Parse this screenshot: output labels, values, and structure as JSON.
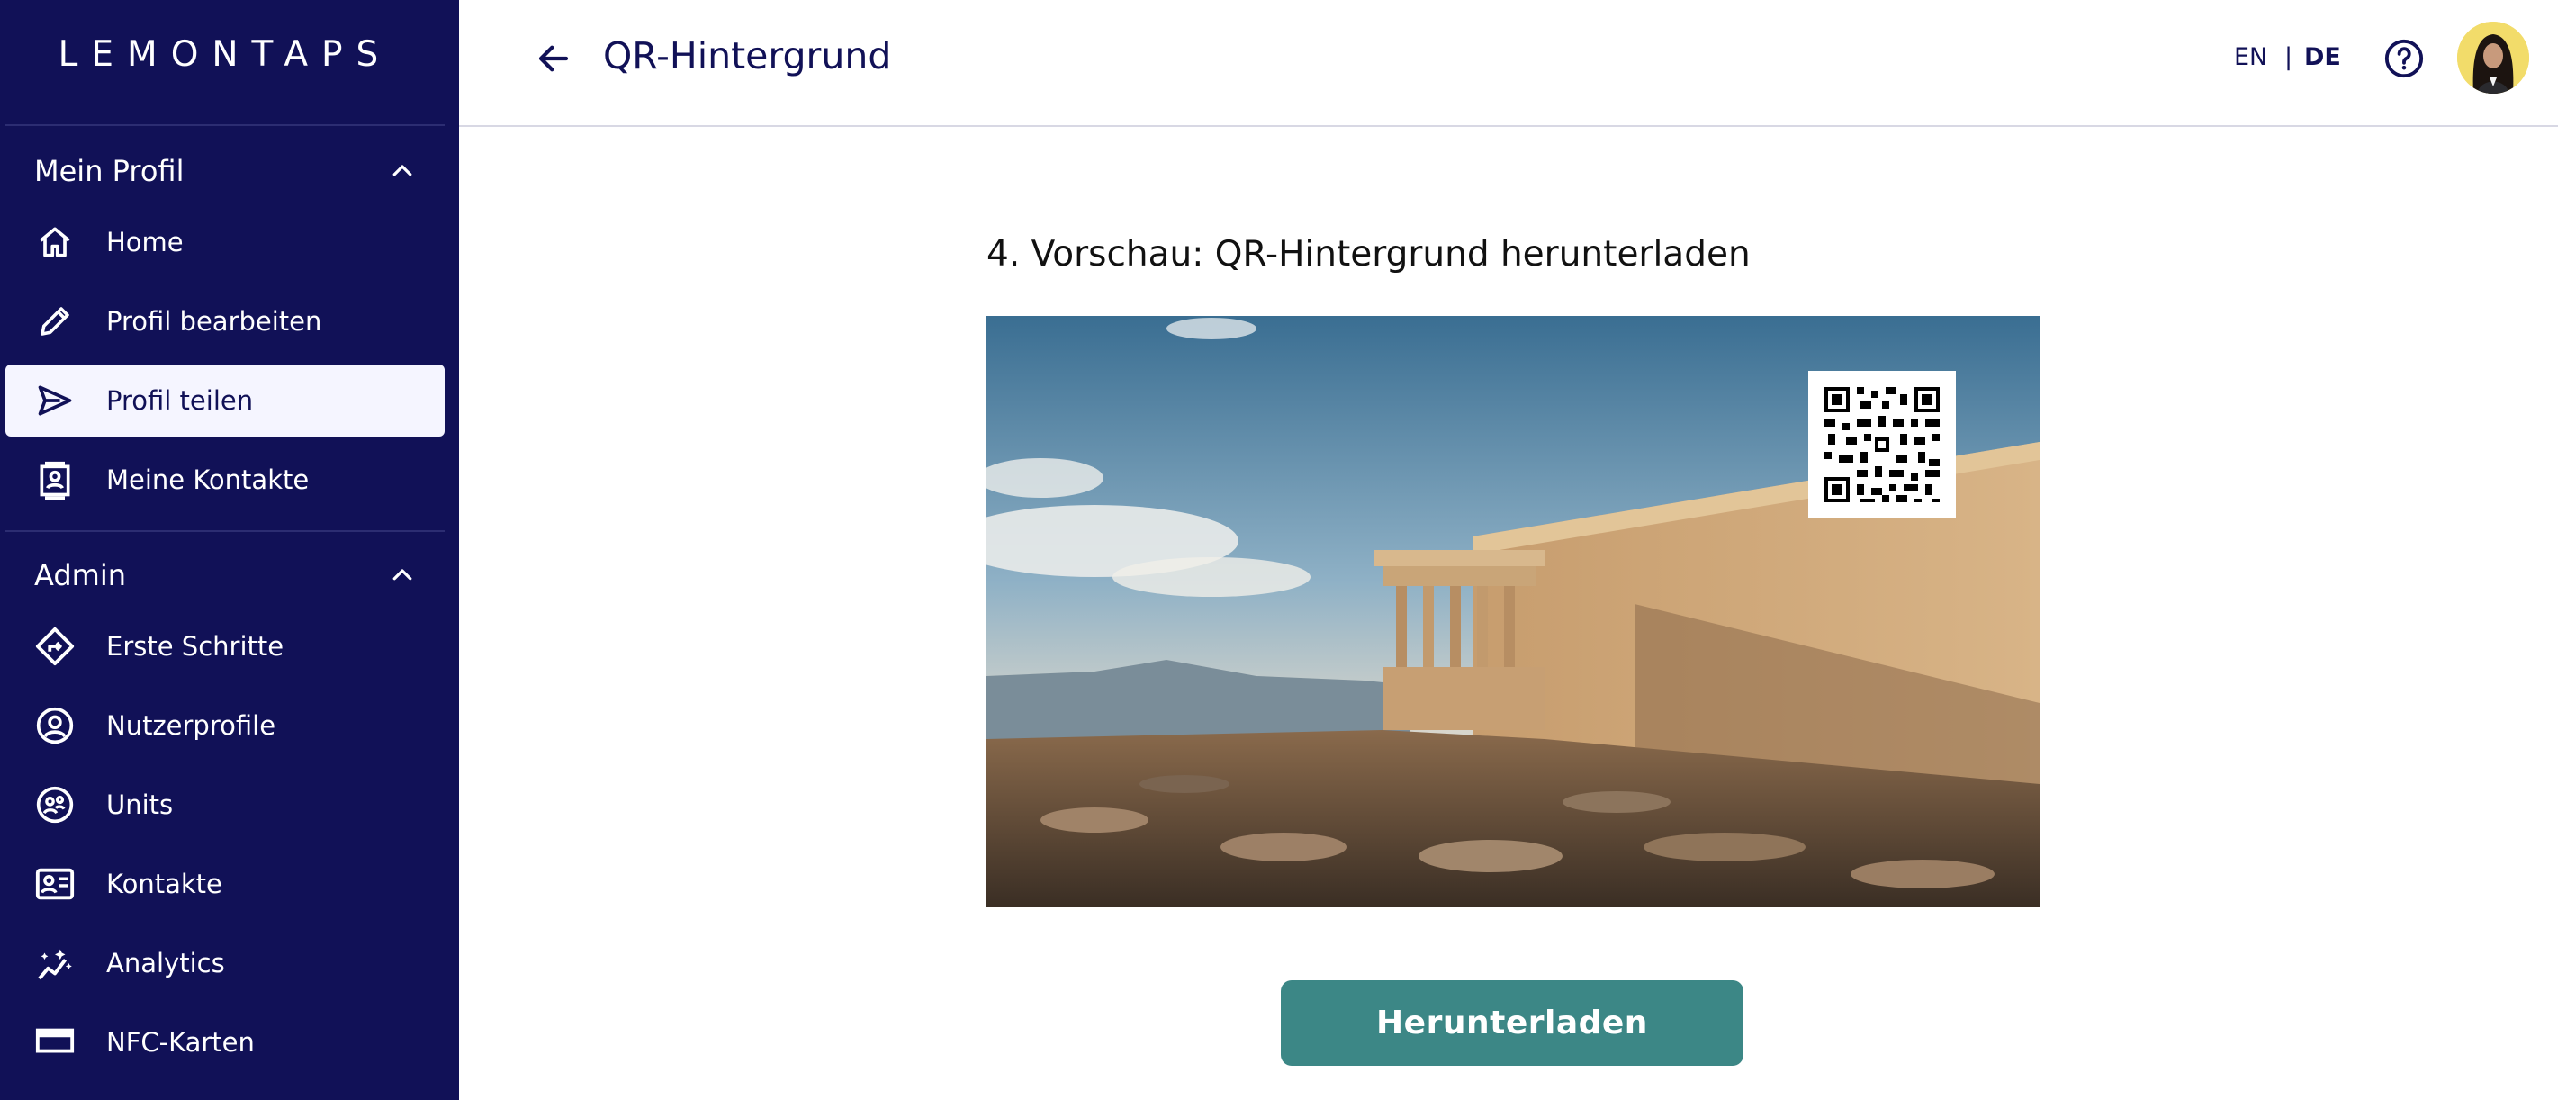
{
  "sidebar": {
    "logo": "LEMONTAPS",
    "sections": [
      {
        "title": "Mein Profil",
        "items": [
          {
            "label": "Home",
            "icon": "home-icon"
          },
          {
            "label": "Profil bearbeiten",
            "icon": "pencil-icon"
          },
          {
            "label": "Profil teilen",
            "icon": "send-icon",
            "active": true
          },
          {
            "label": "Meine Kontakte",
            "icon": "contacts-icon"
          }
        ]
      },
      {
        "title": "Admin",
        "items": [
          {
            "label": "Erste Schritte",
            "icon": "directions-icon"
          },
          {
            "label": "Nutzerprofile",
            "icon": "user-circle-icon"
          },
          {
            "label": "Units",
            "icon": "units-icon"
          },
          {
            "label": "Kontakte",
            "icon": "contact-card-icon"
          },
          {
            "label": "Analytics",
            "icon": "analytics-icon"
          },
          {
            "label": "NFC-Karten",
            "icon": "card-icon"
          }
        ]
      }
    ]
  },
  "header": {
    "title": "QR-Hintergrund",
    "lang_en": "EN",
    "lang_sep": "|",
    "lang_de": "DE",
    "active_lang": "DE"
  },
  "main": {
    "section_title": "4. Vorschau: QR-Hintergrund herunterladen",
    "download_label": "Herunterladen"
  },
  "colors": {
    "sidebar_bg": "#111157",
    "accent": "#3c8786",
    "active_item_bg": "#f5f5ff"
  }
}
